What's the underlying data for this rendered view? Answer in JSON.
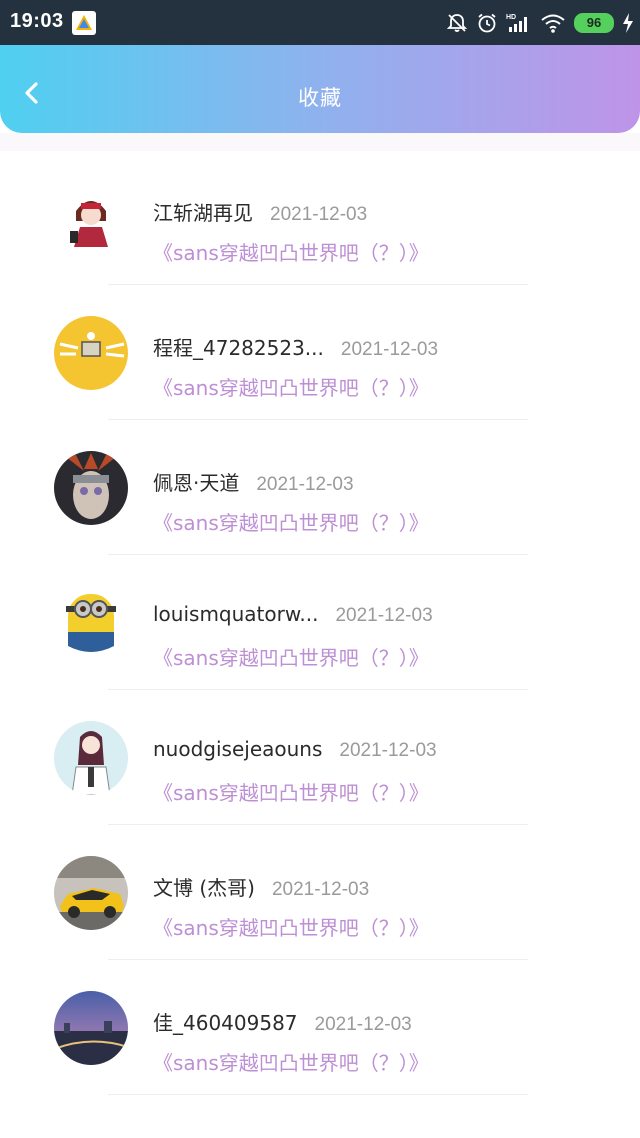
{
  "status_bar": {
    "time": "19:03",
    "battery": "96",
    "icons": [
      "app-badge-icon",
      "mute-bell-icon",
      "alarm-icon",
      "hd-signal-icon",
      "wifi-icon",
      "battery-icon",
      "charging-icon"
    ],
    "colors": {
      "background": "#24323f",
      "battery": "#56d05c"
    }
  },
  "header": {
    "title": "收藏",
    "back_icon": "chevron-left-icon",
    "gradient": [
      "#4fd0f0",
      "#8fb2ee",
      "#bf94e8"
    ]
  },
  "favorites": [
    {
      "name": "江斩湖再见",
      "date": "2021-12-03",
      "title": "《sans穿越凹凸世界吧（？）》",
      "avatar": "anime-girl"
    },
    {
      "name": "程程_47282523...",
      "date": "2021-12-03",
      "title": "《sans穿越凹凸世界吧（？）》",
      "avatar": "yellow-circle"
    },
    {
      "name": "佩恩·天道",
      "date": "2021-12-03",
      "title": "《sans穿越凹凸世界吧（？）》",
      "avatar": "ninja"
    },
    {
      "name": "louismquatorw...",
      "date": "2021-12-03",
      "title": "《sans穿越凹凸世界吧（？）》",
      "avatar": "minion"
    },
    {
      "name": "nuodgisejeaouns",
      "date": "2021-12-03",
      "title": "《sans穿越凹凸世界吧（？）》",
      "avatar": "girl-drawing"
    },
    {
      "name": "文博 (杰哥)",
      "date": "2021-12-03",
      "title": "《sans穿越凹凸世界吧（？）》",
      "avatar": "sports-car"
    },
    {
      "name": "佳_460409587",
      "date": "2021-12-03",
      "title": "《sans穿越凹凸世界吧（？）》",
      "avatar": "city-night"
    }
  ],
  "colors": {
    "title_accent": "#bd8fd4",
    "name": "#2b2b2b",
    "date": "#9a9a9a"
  }
}
